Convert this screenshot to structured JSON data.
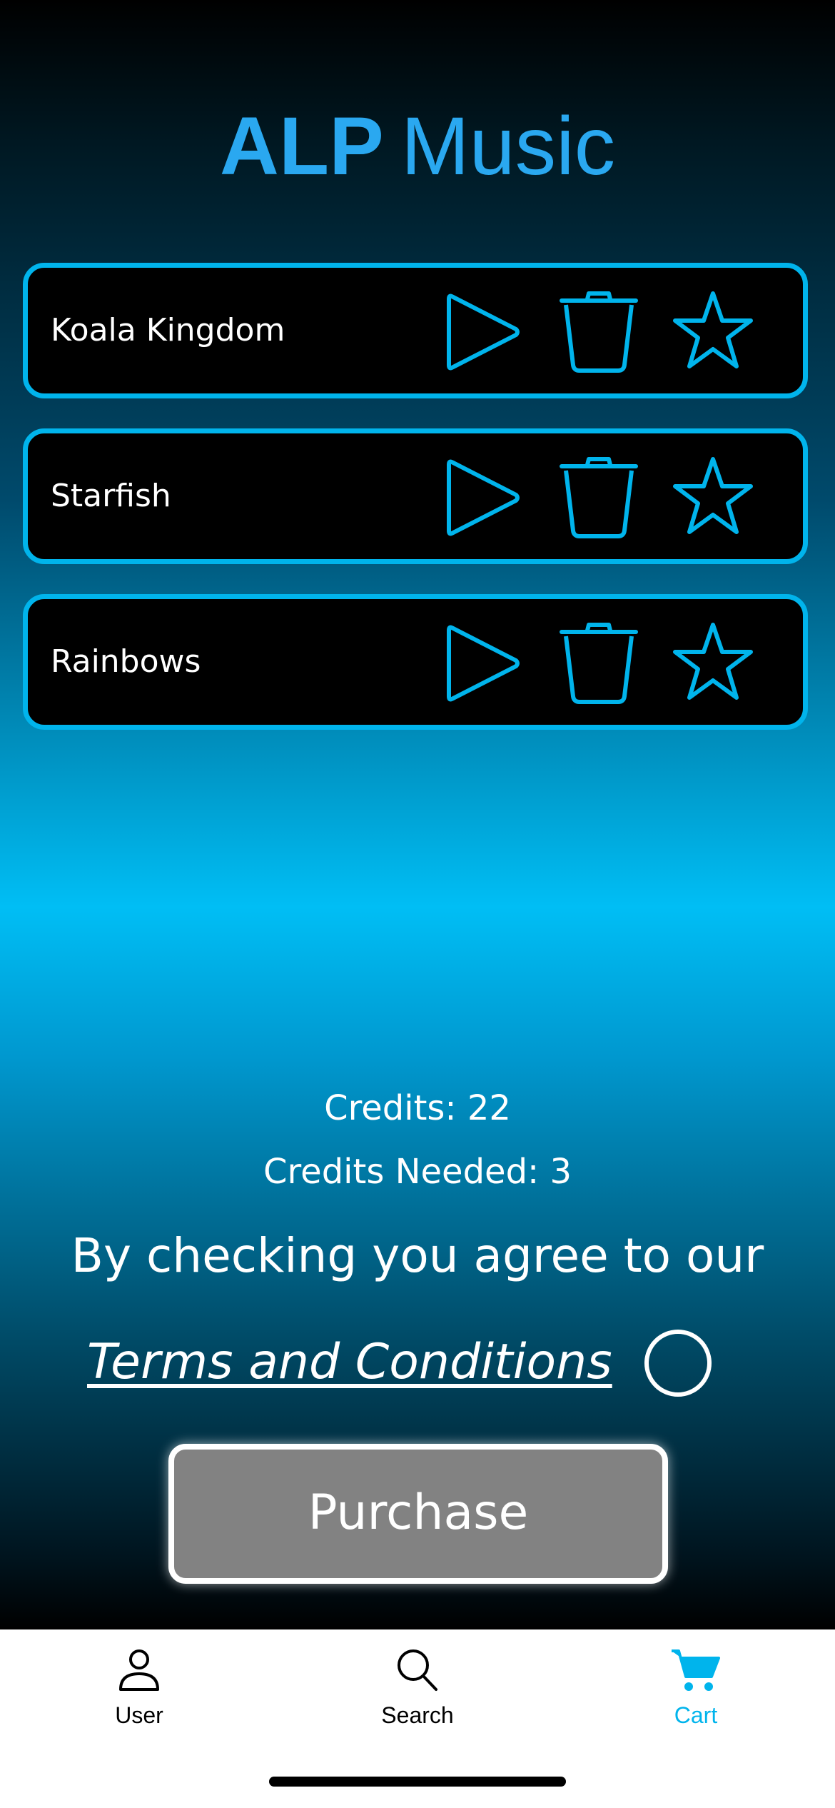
{
  "app": {
    "logo_bold": "ALP",
    "logo_thin": "Music",
    "logo_color": "#2aa8f0",
    "accent_color": "#00b4ec"
  },
  "songs": [
    {
      "title": "Koala Kingdom",
      "icons": [
        "play-icon",
        "trash-icon",
        "star-icon"
      ]
    },
    {
      "title": "Starfish",
      "icons": [
        "play-icon",
        "trash-icon",
        "star-icon"
      ]
    },
    {
      "title": "Rainbows",
      "icons": [
        "play-icon",
        "trash-icon",
        "star-icon"
      ]
    }
  ],
  "credits": {
    "available": "Credits: 22",
    "needed": "Credits Needed: 3"
  },
  "agreement": {
    "text": "By checking you agree to our",
    "terms_link": "Terms and Conditions",
    "checked": false
  },
  "purchase_button": "Purchase",
  "tabbar": {
    "tabs": [
      {
        "label": "User",
        "icon": "user-icon",
        "active": false
      },
      {
        "label": "Search",
        "icon": "search-icon",
        "active": false
      },
      {
        "label": "Cart",
        "icon": "cart-icon",
        "active": true
      }
    ]
  }
}
